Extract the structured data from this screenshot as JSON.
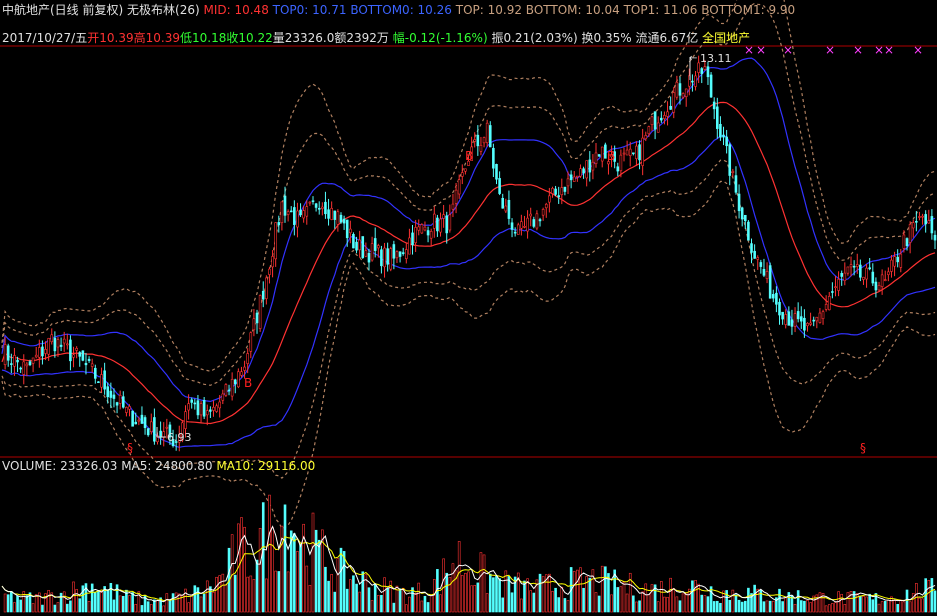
{
  "header": {
    "security": "中航地产(日线 前复权)",
    "indicator": "无极布林(26)",
    "mid": "MID: 10.48",
    "top0": "TOP0: 10.71",
    "bottom0": "BOTTOM0: 10.26",
    "top": "TOP: 10.92",
    "bottom": "BOTTOM: 10.04",
    "top1": "TOP1: 11.06",
    "bottom1": "BOTTOM1: 9.90"
  },
  "quote": {
    "date": "2017/10/27/五",
    "open_label": "开",
    "open": "10.39",
    "high_label": "高",
    "high": "10.39",
    "low_label": "低",
    "low": "10.18",
    "close_label": "收",
    "close": "10.22",
    "volume_label": "量",
    "volume": "23326.0",
    "amount_label": "额",
    "amount": "2392万",
    "change_label": "幅",
    "change": "-0.12(-1.16%)",
    "amplitude_label": "振",
    "amplitude": "0.21(2.03%)",
    "turnover_label": "换",
    "turnover": "0.35%",
    "float_label": "流通",
    "float": "6.67亿",
    "sector": "全国地产"
  },
  "annotations": {
    "high_price": "13.11",
    "low_price": "6.93",
    "buy_marker": "B",
    "s_marker": "§",
    "x_marker": "×"
  },
  "volume_panel": {
    "volume": "VOLUME: 23326.03",
    "ma5": "MA5: 24800.80",
    "ma10": "MA10: 29116.00"
  },
  "colors": {
    "up": "#ff3232",
    "down": "#54ffff",
    "mid_line": "#ff3232",
    "band_line": "#3232ff",
    "outer_band": "#b08060",
    "ma5": "#ffffff",
    "ma10": "#ffff00",
    "cross": "#ff40ff"
  },
  "chart_data": [
    {
      "type": "line",
      "title": "无极布林(26)",
      "series": [
        {
          "name": "MID",
          "last": 10.48
        },
        {
          "name": "TOP0",
          "last": 10.71
        },
        {
          "name": "BOTTOM0",
          "last": 10.26
        },
        {
          "name": "TOP",
          "last": 10.92
        },
        {
          "name": "BOTTOM",
          "last": 10.04
        },
        {
          "name": "TOP1",
          "last": 11.06
        },
        {
          "name": "BOTTOM1",
          "last": 9.9
        }
      ],
      "ylim": [
        6.7,
        13.4
      ],
      "price_path": [
        [
          0,
          8.4
        ],
        [
          8,
          8.1
        ],
        [
          16,
          8.6
        ],
        [
          24,
          8.3
        ],
        [
          32,
          7.9
        ],
        [
          40,
          7.4
        ],
        [
          48,
          7.1
        ],
        [
          56,
          6.95
        ],
        [
          60,
          7.6
        ],
        [
          66,
          7.3
        ],
        [
          72,
          7.7
        ],
        [
          78,
          8.2
        ],
        [
          84,
          9.4
        ],
        [
          90,
          10.8
        ],
        [
          96,
          10.5
        ],
        [
          102,
          10.9
        ],
        [
          108,
          10.6
        ],
        [
          114,
          10.1
        ],
        [
          120,
          10.0
        ],
        [
          126,
          9.9
        ],
        [
          132,
          10.3
        ],
        [
          138,
          10.5
        ],
        [
          144,
          10.5
        ],
        [
          150,
          11.6
        ],
        [
          156,
          12.0
        ],
        [
          160,
          10.9
        ],
        [
          166,
          10.3
        ],
        [
          172,
          10.6
        ],
        [
          180,
          11.1
        ],
        [
          186,
          11.3
        ],
        [
          192,
          11.7
        ],
        [
          198,
          11.5
        ],
        [
          204,
          11.6
        ],
        [
          210,
          12.2
        ],
        [
          216,
          12.6
        ],
        [
          222,
          12.9
        ],
        [
          226,
          13.0
        ],
        [
          230,
          12.2
        ],
        [
          236,
          11.0
        ],
        [
          242,
          10.0
        ],
        [
          248,
          9.3
        ],
        [
          254,
          8.9
        ],
        [
          260,
          8.7
        ],
        [
          266,
          9.3
        ],
        [
          272,
          9.7
        ],
        [
          278,
          9.6
        ],
        [
          284,
          9.5
        ],
        [
          290,
          10.2
        ],
        [
          296,
          10.6
        ],
        [
          300,
          10.22
        ]
      ]
    },
    {
      "type": "bar",
      "title": "VOLUME",
      "series": [
        {
          "name": "VOLUME",
          "last": 23326.03
        },
        {
          "name": "MA5",
          "last": 24800.8
        },
        {
          "name": "MA10",
          "last": 29116.0
        }
      ],
      "ylim": [
        0,
        150000
      ],
      "volume_path": [
        [
          0,
          18000
        ],
        [
          10,
          14000
        ],
        [
          20,
          20000
        ],
        [
          30,
          30000
        ],
        [
          40,
          16000
        ],
        [
          50,
          12000
        ],
        [
          60,
          18000
        ],
        [
          66,
          25000
        ],
        [
          72,
          40000
        ],
        [
          76,
          70000
        ],
        [
          80,
          60000
        ],
        [
          86,
          90000
        ],
        [
          92,
          110000
        ],
        [
          96,
          80000
        ],
        [
          100,
          70000
        ],
        [
          106,
          50000
        ],
        [
          112,
          38000
        ],
        [
          118,
          30000
        ],
        [
          124,
          24000
        ],
        [
          130,
          20000
        ],
        [
          136,
          22000
        ],
        [
          142,
          40000
        ],
        [
          146,
          60000
        ],
        [
          150,
          50000
        ],
        [
          156,
          38000
        ],
        [
          162,
          30000
        ],
        [
          170,
          26000
        ],
        [
          180,
          30000
        ],
        [
          190,
          34000
        ],
        [
          200,
          28000
        ],
        [
          210,
          24000
        ],
        [
          220,
          30000
        ],
        [
          230,
          22000
        ],
        [
          240,
          20000
        ],
        [
          250,
          18000
        ],
        [
          260,
          16000
        ],
        [
          270,
          15000
        ],
        [
          280,
          14000
        ],
        [
          290,
          18000
        ],
        [
          296,
          24000
        ],
        [
          300,
          23326
        ]
      ]
    }
  ]
}
